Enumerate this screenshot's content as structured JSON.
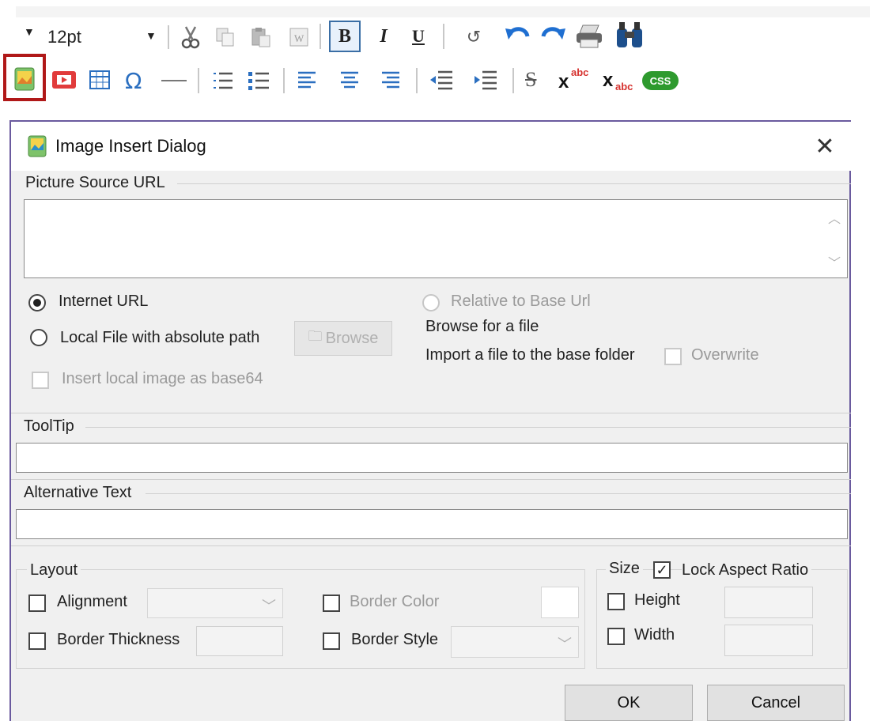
{
  "toolbar": {
    "font_size": "12pt",
    "bold": "B",
    "italic": "I",
    "underline": "U",
    "omega": "Ω",
    "strike": "S",
    "superscript_base": "x",
    "superscript_text": "abc",
    "subscript_base": "x",
    "subscript_text": "abc",
    "css_badge": "CSS",
    "icons": [
      "cut-icon",
      "copy-icon",
      "paste-icon",
      "paste-word-icon",
      "refresh-icon",
      "undo-icon",
      "redo-icon",
      "print-icon",
      "find-icon",
      "insert-image-icon",
      "insert-video-icon",
      "insert-table-icon",
      "special-char-icon",
      "horizontal-rule-icon",
      "numbered-list-icon",
      "bullet-list-icon",
      "align-left-icon",
      "align-center-icon",
      "align-right-icon",
      "outdent-icon",
      "indent-icon"
    ]
  },
  "dialog": {
    "title": "Image Insert Dialog",
    "close": "✕",
    "picture_source_label": "Picture Source URL",
    "picture_source_value": "",
    "internet_url_label": "Internet URL",
    "internet_url_selected": true,
    "local_file_label": "Local File with absolute path",
    "browse_label": "Browse",
    "relative_label": "Relative to Base Url",
    "browse_for_file": "Browse for a file",
    "import_label": "Import a file to the base folder",
    "overwrite_label": "Overwrite",
    "base64_label": "Insert local image as base64",
    "tooltip_label": "ToolTip",
    "tooltip_value": "",
    "alt_text_label": "Alternative Text",
    "alt_text_value": "",
    "layout_label": "Layout",
    "alignment_label": "Alignment",
    "border_thickness_label": "Border Thickness",
    "border_color_label": "Border Color",
    "border_style_label": "Border Style",
    "size_label": "Size",
    "lock_aspect_label": "Lock Aspect Ratio",
    "lock_aspect_checked": true,
    "height_label": "Height",
    "width_label": "Width",
    "ok_label": "OK",
    "cancel_label": "Cancel"
  }
}
